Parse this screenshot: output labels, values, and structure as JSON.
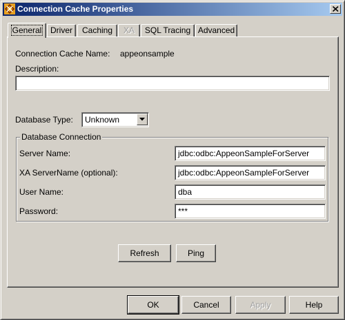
{
  "window": {
    "title": "Connection Cache Properties",
    "icon": "app-logo-icon",
    "close_icon": "close-icon"
  },
  "tabs": [
    {
      "label": "General",
      "active": true
    },
    {
      "label": "Driver"
    },
    {
      "label": "Caching"
    },
    {
      "label": "XA",
      "disabled": true
    },
    {
      "label": "SQL Tracing"
    },
    {
      "label": "Advanced"
    }
  ],
  "general": {
    "cache_name_label": "Connection Cache Name:",
    "cache_name_value": "appeonsample",
    "description_label": "Description:",
    "description_value": "",
    "database_type_label": "Database Type:",
    "database_type_value": "Unknown",
    "group_title": "Database Connection",
    "fields": [
      {
        "label": "Server Name:",
        "value": "jdbc:odbc:AppeonSampleForServer"
      },
      {
        "label": "XA ServerName (optional):",
        "value": "jdbc:odbc:AppeonSampleForServer"
      },
      {
        "label": "User Name:",
        "value": "dba"
      },
      {
        "label": "Password:",
        "value": "***"
      }
    ],
    "refresh_label": "Refresh",
    "ping_label": "Ping"
  },
  "footer": {
    "ok_label": "OK",
    "cancel_label": "Cancel",
    "apply_label": "Apply",
    "help_label": "Help"
  }
}
